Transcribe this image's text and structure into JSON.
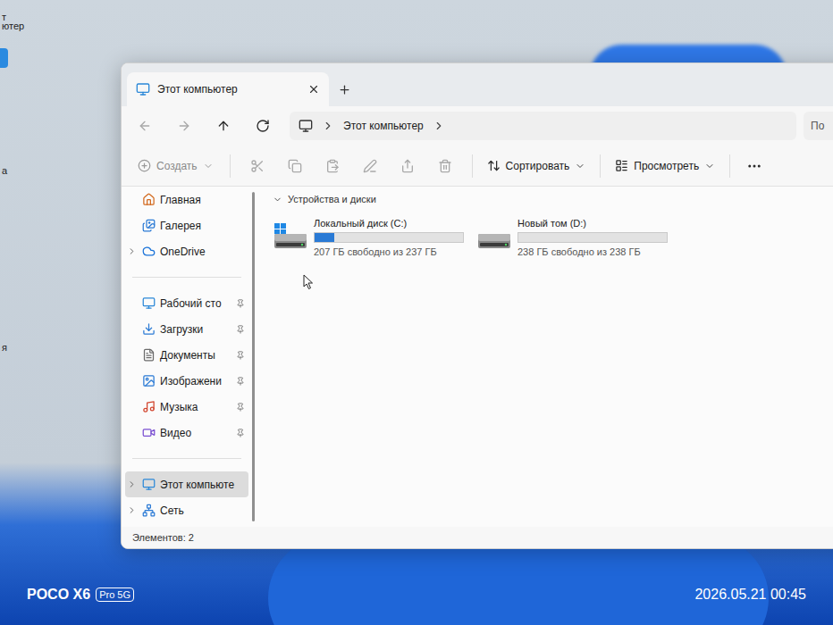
{
  "desktop": {
    "fragments": [
      "т",
      "ютер",
      "а",
      "я"
    ]
  },
  "window": {
    "title": "Этот компьютер"
  },
  "tabs": [
    {
      "label": "Этот компьютер",
      "selected": true
    }
  ],
  "navigation": [
    {
      "disabled": true
    },
    {
      "disabled": true
    },
    {
      "disabled": false
    },
    {
      "disabled": false
    }
  ],
  "address": {
    "path": [
      "Этот компьютер"
    ]
  },
  "search": {
    "placeholder": "По"
  },
  "toolbar": {
    "create": "Создать",
    "actions": [
      {
        "disabled": true
      },
      {
        "disabled": true
      },
      {
        "disabled": true
      },
      {
        "disabled": true
      },
      {
        "disabled": true
      },
      {
        "disabled": true
      }
    ],
    "sort": "Сортировать",
    "view": "Просмотреть"
  },
  "sidebar": {
    "sections": [
      {
        "items": [
          {
            "label": "Главная",
            "expandable": false,
            "expanded": false,
            "pinned": false,
            "selected": false
          },
          {
            "label": "Галерея",
            "expandable": false,
            "expanded": false,
            "pinned": false,
            "selected": false
          },
          {
            "label": "OneDrive",
            "expandable": true,
            "expanded": false,
            "pinned": false,
            "selected": false
          }
        ]
      },
      {
        "items": [
          {
            "label": "Рабочий сто",
            "expandable": false,
            "expanded": false,
            "pinned": true,
            "selected": false
          },
          {
            "label": "Загрузки",
            "expandable": false,
            "expanded": false,
            "pinned": true,
            "selected": false
          },
          {
            "label": "Документы",
            "expandable": false,
            "expanded": false,
            "pinned": true,
            "selected": false
          },
          {
            "label": "Изображени",
            "expandable": false,
            "expanded": false,
            "pinned": true,
            "selected": false
          },
          {
            "label": "Музыка",
            "expandable": false,
            "expanded": false,
            "pinned": true,
            "selected": false
          },
          {
            "label": "Видео",
            "expandable": false,
            "expanded": false,
            "pinned": true,
            "selected": false
          }
        ]
      },
      {
        "items": [
          {
            "label": "Этот компьюте",
            "expandable": true,
            "expanded": false,
            "pinned": false,
            "selected": true
          },
          {
            "label": "Сеть",
            "expandable": true,
            "expanded": false,
            "pinned": false,
            "selected": false
          }
        ]
      }
    ]
  },
  "group": {
    "label": "Устройства и диски",
    "expanded": true
  },
  "drives": [
    {
      "name": "Локальный диск (C:)",
      "free": "207 ГБ свободно из 237 ГБ",
      "level": 0.13,
      "kind": "system"
    },
    {
      "name": "Новый том (D:)",
      "free": "238 ГБ свободно из 238 ГБ",
      "level": 0,
      "kind": "data"
    }
  ],
  "status_bar": {
    "count": "Элементов: 2"
  },
  "watermark": {
    "brand": "POCO X6",
    "badge": "Pro 5G",
    "timestamp": "2026.05.21 00:45"
  }
}
